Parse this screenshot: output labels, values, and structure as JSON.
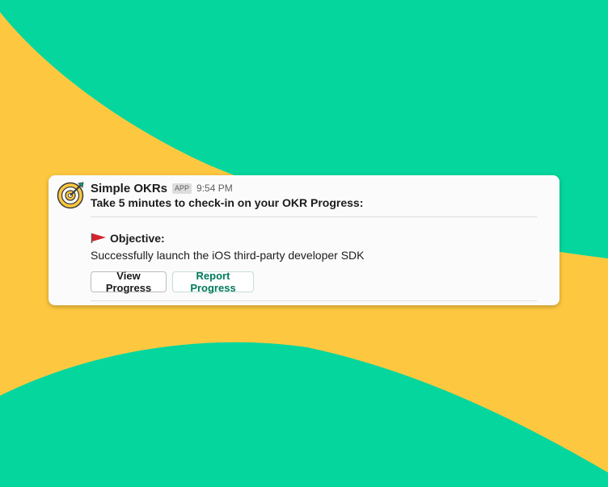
{
  "message": {
    "app_name": "Simple OKRs",
    "badge": "APP",
    "timestamp": "9:54 PM",
    "prompt": "Take 5 minutes to check-in on your OKR Progress:",
    "objective_icon": "red-flag-icon",
    "objective_label": "Objective:",
    "objective_text": "Successfully launch the iOS third-party developer SDK"
  },
  "actions": {
    "view_label": "View Progress",
    "report_label": "Report Progress"
  },
  "colors": {
    "background_green": "#05d69e",
    "background_yellow": "#fdc840",
    "card": "#fbfbfb",
    "report_text": "#007a5a",
    "flag": "#d4232e"
  }
}
